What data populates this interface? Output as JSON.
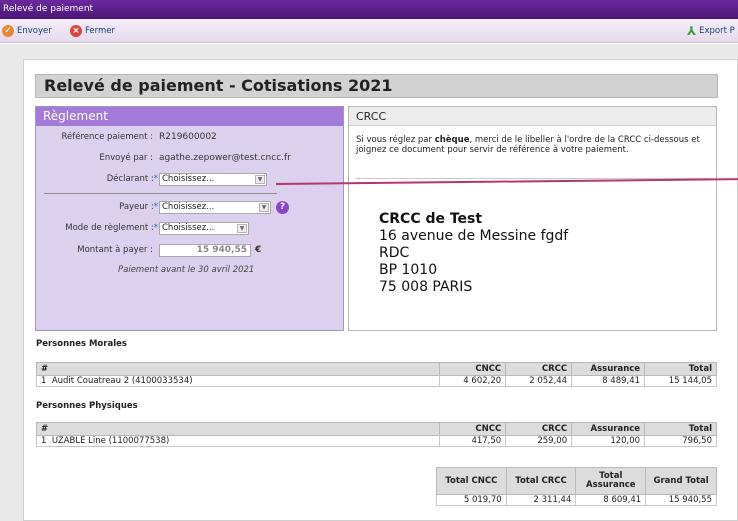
{
  "window": {
    "title": "Relevé de paiement"
  },
  "toolbar": {
    "send_label": "Envoyer",
    "close_label": "Fermer",
    "export_label": "Export P"
  },
  "header": {
    "title": "Relevé de paiement - Cotisations 2021"
  },
  "reglement": {
    "title": "Règlement",
    "reference_label": "Référence paiement :",
    "reference_value": "R219600002",
    "sent_by_label": "Envoyé par :",
    "sent_by_value": "agathe.zepower@test.cncc.fr",
    "declarant_label": "Déclarant :",
    "declarant_value": "Choisissez...",
    "payer_label": "Payeur :",
    "payer_value": "Choisissez...",
    "mode_label": "Mode de règlement :",
    "mode_value": "Choisissez...",
    "amount_label": "Montant à payer :",
    "amount_value": "15 940,55",
    "currency": "€",
    "required_mark": "*",
    "help_icon_text": "?",
    "deadline_note": "Paiement avant le 30 avril 2021"
  },
  "crcc": {
    "title": "CRCC",
    "instructions_pre": "Si vous réglez par ",
    "instructions_bold": "chèque",
    "instructions_post": ", merci de le libeller à l'ordre de la CRCC ci-dessous et joignez ce document pour servir de référence à votre paiement.",
    "address_name": "CRCC de Test",
    "address_line1": "16 avenue de Messine fgdf",
    "address_line2": "RDC",
    "address_line3": "BP 1010",
    "address_line4": "75 008 PARIS"
  },
  "personnes_morales": {
    "title": "Personnes Morales",
    "headers": [
      "#",
      "CNCC",
      "CRCC",
      "Assurance",
      "Total"
    ],
    "rows": [
      {
        "num": "1",
        "name": "Audit Couatreau 2 (4100033534)",
        "cncc": "4 602,20",
        "crcc": "2 052,44",
        "assurance": "8 489,41",
        "total": "15 144,05"
      }
    ]
  },
  "personnes_physiques": {
    "title": "Personnes Physiques",
    "headers": [
      "#",
      "CNCC",
      "CRCC",
      "Assurance",
      "Total"
    ],
    "rows": [
      {
        "num": "1",
        "name": "UZABLE Line (1100077538)",
        "cncc": "417,50",
        "crcc": "259,00",
        "assurance": "120,00",
        "total": "796,50"
      }
    ]
  },
  "totals": {
    "headers": [
      "Total CNCC",
      "Total CRCC",
      "Total Assurance",
      "Grand Total"
    ],
    "values": [
      "5 019,70",
      "2 311,44",
      "8 609,41",
      "15 940,55"
    ]
  },
  "colors": {
    "titlebar": "#4b1577",
    "panel_purple": "#dcd0ef",
    "panel_header": "#a47ad8",
    "arrow": "#b5356e"
  }
}
